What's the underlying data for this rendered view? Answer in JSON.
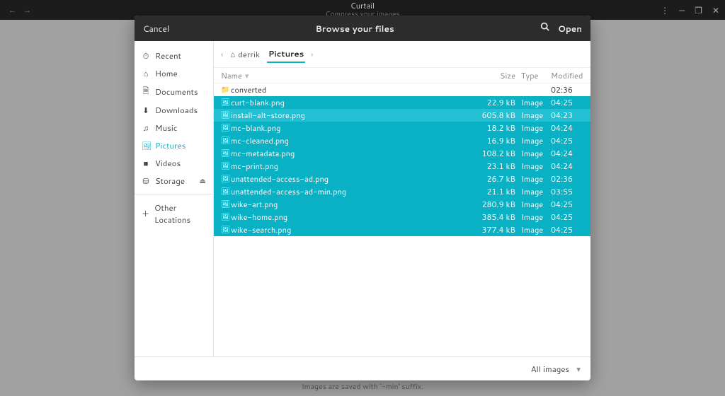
{
  "titlebar": {
    "app_name": "Curtail",
    "subtitle": "Compress your images"
  },
  "dialog": {
    "cancel": "Cancel",
    "title": "Browse your files",
    "open": "Open",
    "filter": "All images"
  },
  "sidebar": {
    "items": [
      {
        "icon": "⏱",
        "label": "Recent"
      },
      {
        "icon": "⌂",
        "label": "Home"
      },
      {
        "icon": "🗎",
        "label": "Documents"
      },
      {
        "icon": "⬇",
        "label": "Downloads"
      },
      {
        "icon": "♫",
        "label": "Music"
      },
      {
        "icon": "🖼",
        "label": "Pictures"
      },
      {
        "icon": "■",
        "label": "Videos"
      },
      {
        "icon": "⛁",
        "label": "Storage"
      }
    ],
    "other": "Other Locations"
  },
  "pathbar": {
    "crumbs": [
      "derrik",
      "Pictures"
    ]
  },
  "columns": {
    "name": "Name",
    "size": "Size",
    "type": "Type",
    "modified": "Modified"
  },
  "files": [
    {
      "kind": "folder",
      "name": "converted",
      "size": "",
      "type": "",
      "modified": "02:36",
      "state": "none"
    },
    {
      "kind": "image",
      "name": "curt-blank.png",
      "size": "22.9 kB",
      "type": "Image",
      "modified": "04:25",
      "state": "sel"
    },
    {
      "kind": "image",
      "name": "install-alt-store.png",
      "size": "605.8 kB",
      "type": "Image",
      "modified": "04:23",
      "state": "sel-focus"
    },
    {
      "kind": "image",
      "name": "mc-blank.png",
      "size": "18.2 kB",
      "type": "Image",
      "modified": "04:24",
      "state": "sel"
    },
    {
      "kind": "image",
      "name": "mc-cleaned.png",
      "size": "16.9 kB",
      "type": "Image",
      "modified": "04:25",
      "state": "sel"
    },
    {
      "kind": "image",
      "name": "mc-metadata.png",
      "size": "108.2 kB",
      "type": "Image",
      "modified": "04:24",
      "state": "sel"
    },
    {
      "kind": "image",
      "name": "mc-print.png",
      "size": "23.1 kB",
      "type": "Image",
      "modified": "04:24",
      "state": "sel"
    },
    {
      "kind": "image",
      "name": "unattended-access-ad.png",
      "size": "26.7 kB",
      "type": "Image",
      "modified": "02:36",
      "state": "sel"
    },
    {
      "kind": "image",
      "name": "unattended-access-ad-min.png",
      "size": "21.1 kB",
      "type": "Image",
      "modified": "03:55",
      "state": "sel"
    },
    {
      "kind": "image",
      "name": "wike-art.png",
      "size": "280.9 kB",
      "type": "Image",
      "modified": "04:25",
      "state": "sel"
    },
    {
      "kind": "image",
      "name": "wike-home.png",
      "size": "385.4 kB",
      "type": "Image",
      "modified": "04:25",
      "state": "sel"
    },
    {
      "kind": "image",
      "name": "wike-search.png",
      "size": "377.4 kB",
      "type": "Image",
      "modified": "04:25",
      "state": "sel"
    }
  ],
  "hint": "Images are saved with '-min' suffix."
}
